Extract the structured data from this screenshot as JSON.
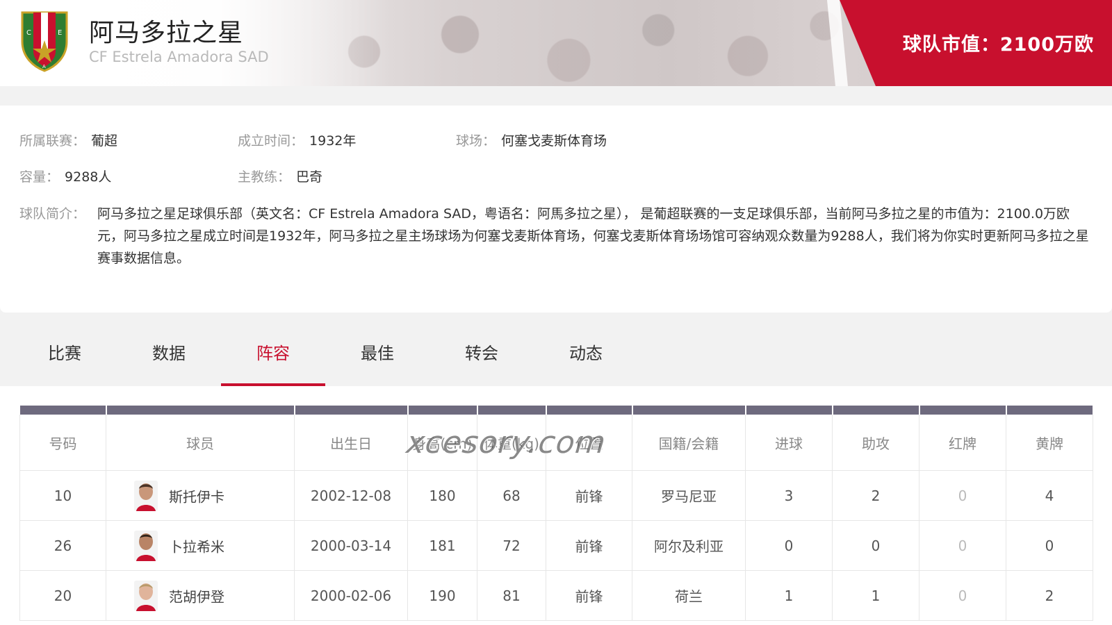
{
  "header": {
    "team_name": "阿马多拉之星",
    "team_name_en": "CF Estrela Amadora SAD",
    "market_value": "球队市值：2100万欧",
    "logo_text": "CFEA",
    "logo_letters": {
      "c": "C",
      "e": "E",
      "a": "A"
    }
  },
  "info": {
    "league_key": "所属联赛：",
    "league": "葡超",
    "founded_key": "成立时间：",
    "founded": "1932年",
    "stadium_key": "球场：",
    "stadium": "何塞戈麦斯体育场",
    "capacity_key": "容量：",
    "capacity": "9288人",
    "coach_key": "主教练：",
    "coach": "巴奇",
    "intro_key": "球队简介：",
    "intro": "阿马多拉之星足球俱乐部（英文名：CF Estrela Amadora SAD，粤语名：阿馬多拉之星）， 是葡超联赛的一支足球俱乐部，当前阿马多拉之星的市值为：2100.0万欧元，阿马多拉之星成立时间是1932年，阿马多拉之星主场球场为何塞戈麦斯体育场，何塞戈麦斯体育场场馆可容纳观众数量为9288人，我们将为你实时更新阿马多拉之星赛事数据信息。"
  },
  "tabs": [
    {
      "label": "比赛",
      "active": false
    },
    {
      "label": "数据",
      "active": false
    },
    {
      "label": "阵容",
      "active": true
    },
    {
      "label": "最佳",
      "active": false
    },
    {
      "label": "转会",
      "active": false
    },
    {
      "label": "动态",
      "active": false
    }
  ],
  "table": {
    "headers": [
      "号码",
      "球员",
      "出生日",
      "身高(cm)",
      "体重(kg)",
      "位置",
      "国籍/会籍",
      "进球",
      "助攻",
      "红牌",
      "黄牌"
    ],
    "rows": [
      {
        "number": "10",
        "player": "斯托伊卡",
        "birth": "2002-12-08",
        "height": "180",
        "weight": "68",
        "position": "前锋",
        "nationality": "罗马尼亚",
        "goals": "3",
        "assists": "2",
        "red": "0",
        "yellow": "4"
      },
      {
        "number": "26",
        "player": "卜拉希米",
        "birth": "2000-03-14",
        "height": "181",
        "weight": "72",
        "position": "前锋",
        "nationality": "阿尔及利亚",
        "goals": "0",
        "assists": "0",
        "red": "0",
        "yellow": "0"
      },
      {
        "number": "20",
        "player": "范胡伊登",
        "birth": "2000-02-06",
        "height": "190",
        "weight": "81",
        "position": "前锋",
        "nationality": "荷兰",
        "goals": "1",
        "assists": "1",
        "red": "0",
        "yellow": "2"
      }
    ]
  },
  "watermark": "xcesory.com",
  "colors": {
    "accent": "#c8102e",
    "header_bar": "#6e6a7e"
  }
}
